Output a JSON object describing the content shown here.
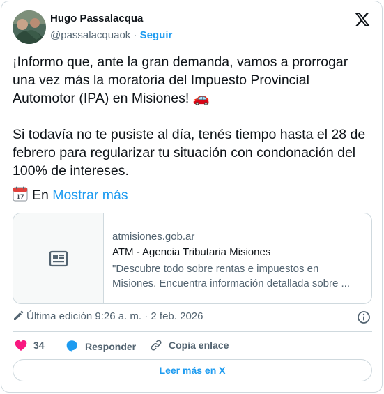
{
  "author": {
    "name": "Hugo Passalacqua",
    "handle": "@passalacquaok",
    "separator": " · ",
    "follow_label": "Seguir"
  },
  "tweet": {
    "paragraph1": "¡Informo que, ante la gran demanda, vamos a prorrogar una vez más la moratoria del Impuesto Provincial Automotor (IPA) en Misiones! 🚗",
    "paragraph2": "Si todavía no te pusiste al día, tenés tiempo hasta el 28 de febrero para regularizar tu situación con condonación del 100% de intereses.",
    "truncated_prefix": "En",
    "show_more": "Mostrar más"
  },
  "link_card": {
    "domain": "atmisiones.gob.ar",
    "title": "ATM - Agencia Tributaria Misiones",
    "description": "\"Descubre todo sobre rentas e impuestos en Misiones. Encuentra información detallada sobre ..."
  },
  "meta": {
    "edit_text": "Última edición 9:26 a. m. · 2 feb. 2026"
  },
  "actions": {
    "like_count": "34",
    "reply_label": "Responder",
    "copy_label": "Copia enlace"
  },
  "read_more_label": "Leer más en X",
  "colors": {
    "accent": "#1d9bf0",
    "like": "#f91880",
    "text": "#0f1419",
    "secondary": "#536471",
    "border": "#cfd9de"
  },
  "icons": [
    "x-logo-icon",
    "calendar-icon",
    "article-icon",
    "pencil-icon",
    "info-icon",
    "heart-icon",
    "reply-icon",
    "link-icon"
  ]
}
